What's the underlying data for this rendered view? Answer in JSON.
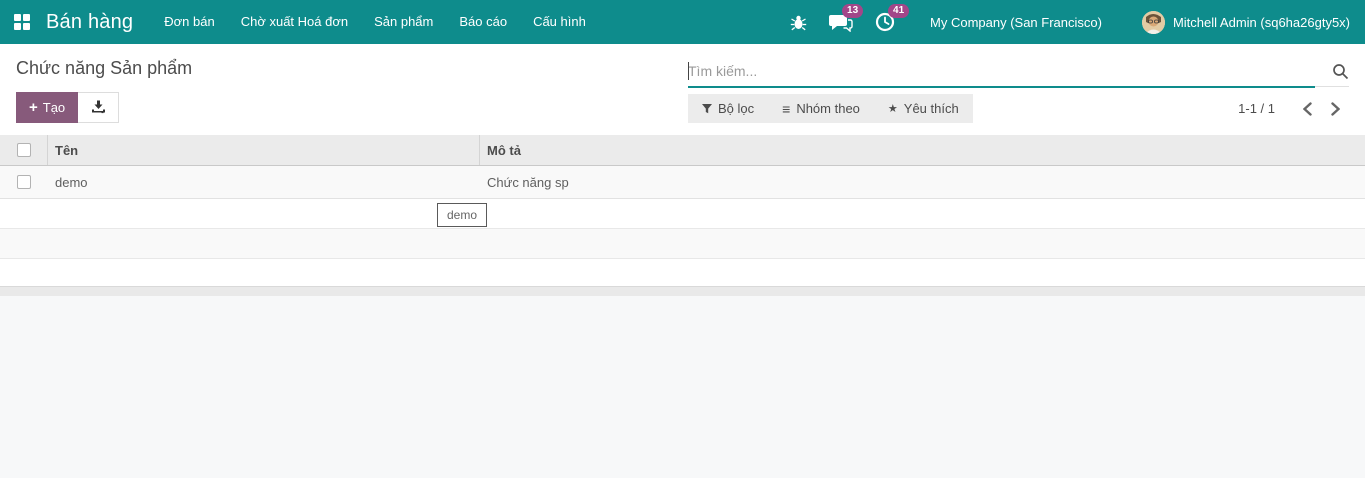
{
  "colors": {
    "navbar_bg": "#0e8c8c",
    "badge": "#a24689",
    "create_btn": "#875a7b",
    "underline": "#0e8c8c"
  },
  "navbar": {
    "brand": "Bán hàng",
    "items": [
      "Đơn bán",
      "Chờ xuất Hoá đơn",
      "Sản phẩm",
      "Báo cáo",
      "Cấu hình"
    ],
    "messages_badge": "13",
    "activities_badge": "41",
    "company": "My Company (San Francisco)",
    "user": "Mitchell Admin (sq6ha26gty5x)"
  },
  "control_panel": {
    "title": "Chức năng Sản phẩm",
    "create_label": "Tạo",
    "search_placeholder": "Tìm kiếm...",
    "filter_label": "Bộ lọc",
    "groupby_label": "Nhóm theo",
    "favorite_label": "Yêu thích",
    "pager_value": "1-1 / 1"
  },
  "table": {
    "columns": [
      "Tên",
      "Mô tả"
    ],
    "rows": [
      {
        "name": "demo",
        "description": "Chức năng sp"
      }
    ]
  },
  "tooltip": {
    "text": "demo"
  }
}
